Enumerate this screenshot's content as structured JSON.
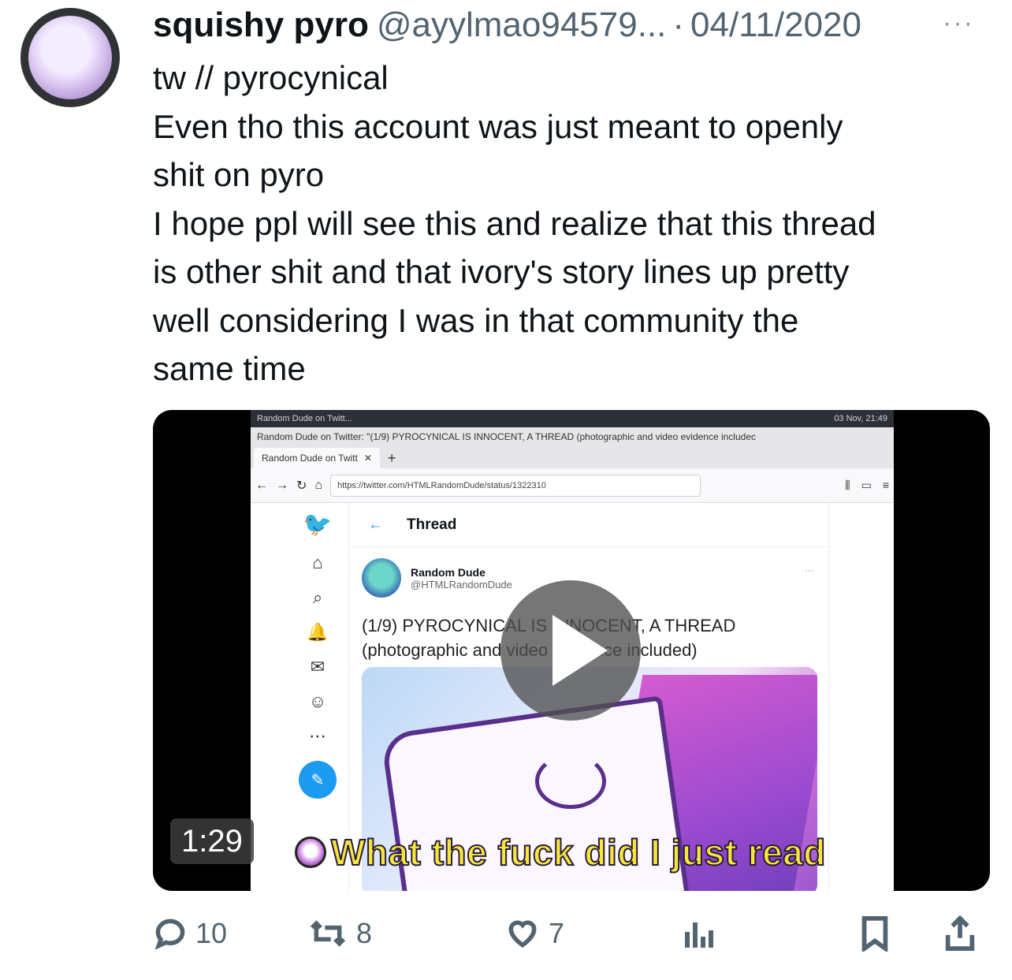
{
  "tweet": {
    "display_name": "squishy pyro",
    "handle": "@ayylmao94579...",
    "separator": "·",
    "date": "04/11/2020",
    "more_label": "···",
    "lines": [
      "tw // pyrocynical",
      "Even tho this account was just meant to openly",
      "shit on pyro",
      "I hope ppl will see this and realize that this thread",
      "is other shit and that ivory's story lines up pretty",
      "well considering I was in that community the",
      "same time"
    ]
  },
  "video": {
    "duration": "1:29",
    "caption": "What the fuck did I just read",
    "screen": {
      "sys_left": "Random Dude on Twitt...",
      "sys_right": "03 Nov, 21:49",
      "window_title": "Random Dude on Twitter: \"(1/9) PYROCYNICAL IS INNOCENT, A THREAD (photographic and video evidence includec",
      "tab_label": "Random Dude on Twitt",
      "url": "https://twitter.com/HTMLRandomDude/status/1322310",
      "thread_header": "Thread",
      "author_name": "Random Dude",
      "author_handle": "@HTMLRandomDude",
      "post_line1": "(1/9) PYROCYNICAL IS INNOCENT, A THREAD",
      "post_line2": "(photographic and video evidence included)"
    }
  },
  "actions": {
    "replies": "10",
    "retweets": "8",
    "likes": "7"
  },
  "icons": {
    "reply": "reply-icon",
    "retweet": "retweet-icon",
    "like": "heart-icon",
    "views": "views-chart-icon",
    "bookmark": "bookmark-icon",
    "share": "share-icon"
  }
}
